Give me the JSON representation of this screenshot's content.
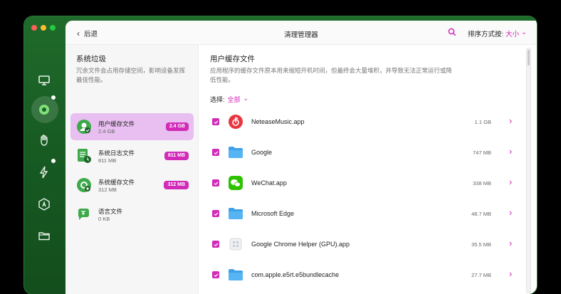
{
  "window": {
    "back_label": "后退",
    "title": "清理管理器",
    "sort_label": "排序方式按:",
    "sort_value": "大小",
    "accent": "#d12bb8"
  },
  "sidebar_icons": [
    "monitor-icon",
    "smart-scan-icon",
    "hand-icon",
    "bolt-icon",
    "app-store-icon",
    "folder-icon"
  ],
  "left": {
    "heading": "系统垃圾",
    "description": "冗余文件会占用存储空间，影响设备发挥最佳性能。",
    "categories": [
      {
        "name": "用户缓存文件",
        "size": "2.4 GB",
        "badge": "2.4 GB"
      },
      {
        "name": "系统日志文件",
        "size": "811 MB",
        "badge": "811 MB"
      },
      {
        "name": "系统缓存文件",
        "size": "312 MB",
        "badge": "312 MB"
      },
      {
        "name": "语言文件",
        "size": "0 KB",
        "badge": ""
      }
    ]
  },
  "right": {
    "heading": "用户缓存文件",
    "description": "应用程序的缓存文件原本用来缩短开机时间，但最终会大量堆积，并导致无法正常运行或降低性能。",
    "filter_label": "选择:",
    "filter_value": "全部",
    "items": [
      {
        "name": "NeteaseMusic.app",
        "size": "1.1 GB",
        "icon": "netease-music-icon"
      },
      {
        "name": "Google",
        "size": "747 MB",
        "icon": "folder-icon"
      },
      {
        "name": "WeChat.app",
        "size": "338 MB",
        "icon": "wechat-icon"
      },
      {
        "name": "Microsoft Edge",
        "size": "48.7 MB",
        "icon": "folder-icon"
      },
      {
        "name": "Google Chrome Helper (GPU).app",
        "size": "35.5 MB",
        "icon": "app-generic-icon"
      },
      {
        "name": "com.apple.e5rt.e5bundlecache",
        "size": "27.7 MB",
        "icon": "folder-icon"
      }
    ]
  }
}
